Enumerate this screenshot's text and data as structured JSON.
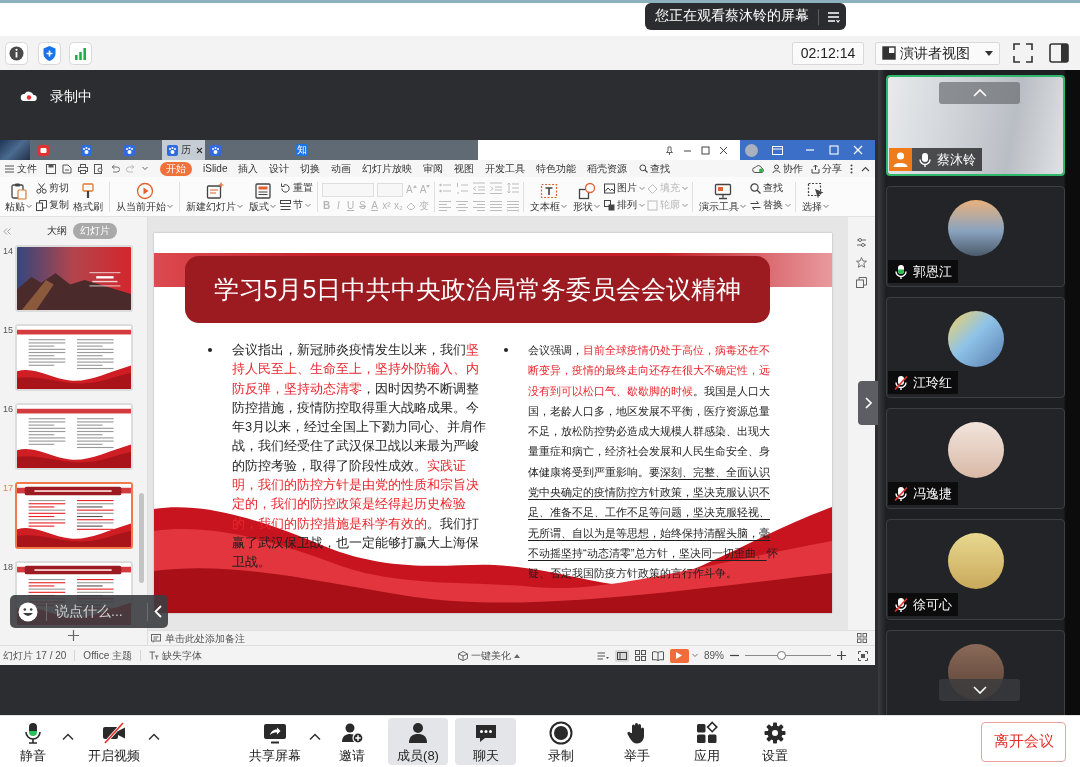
{
  "screen_share_banner": {
    "text": "您正在观看蔡沐铃的屏幕"
  },
  "meeting_bar": {
    "timer": "02:12:14",
    "view_mode": "演讲者视图"
  },
  "recording": {
    "label": "录制中"
  },
  "shared_window": {
    "browser_tabs": [
      {
        "kind": "app",
        "selected": false
      },
      {
        "kind": "paw",
        "selected": false
      },
      {
        "kind": "paw",
        "selected": false
      },
      {
        "kind": "paw",
        "selected": true,
        "label": "历"
      },
      {
        "kind": "paw",
        "selected": false
      },
      {
        "kind": "letter",
        "icon_text": "知",
        "selected": false
      }
    ],
    "menu": {
      "file": "文件",
      "tabs": [
        {
          "label": "开始",
          "selected": true
        },
        {
          "label": "iSlide",
          "selected": false
        },
        {
          "label": "插入",
          "selected": false
        },
        {
          "label": "设计",
          "selected": false
        },
        {
          "label": "切换",
          "selected": false
        },
        {
          "label": "动画",
          "selected": false
        },
        {
          "label": "幻灯片放映",
          "selected": false
        },
        {
          "label": "审阅",
          "selected": false
        },
        {
          "label": "视图",
          "selected": false
        },
        {
          "label": "开发工具",
          "selected": false
        },
        {
          "label": "特色功能",
          "selected": false
        },
        {
          "label": "稻壳资源",
          "selected": false
        }
      ],
      "search": "查找",
      "actions": [
        "协作",
        "分享"
      ]
    },
    "ribbon": [
      {
        "kind": "large",
        "label": "粘贴",
        "dropdown": true,
        "disabled": false
      },
      {
        "kind": "stack",
        "items": [
          {
            "label": "剪切",
            "dropdown": false,
            "disabled": false
          },
          {
            "label": "复制",
            "dropdown": false,
            "disabled": false
          }
        ]
      },
      {
        "kind": "large",
        "label": "格式刷",
        "dropdown": false,
        "disabled": false
      },
      {
        "kind": "separator"
      },
      {
        "kind": "large",
        "label": "从当前开始",
        "dropdown": true,
        "disabled": false
      },
      {
        "kind": "separator"
      },
      {
        "kind": "large",
        "label": "新建幻灯片",
        "dropdown": true,
        "disabled": false
      },
      {
        "kind": "large",
        "label": "版式",
        "dropdown": true,
        "disabled": false
      },
      {
        "kind": "stack",
        "items": [
          {
            "label": "重置",
            "dropdown": false,
            "disabled": false
          },
          {
            "label": "节",
            "dropdown": true,
            "disabled": false
          }
        ]
      },
      {
        "kind": "separator"
      },
      {
        "kind": "font_tools",
        "disabled": true,
        "size_buttons": [
          "A",
          "A"
        ],
        "format_buttons": [
          "B",
          "I",
          "U",
          "S",
          "A",
          "x²",
          "x₂",
          "变"
        ]
      },
      {
        "kind": "separator"
      },
      {
        "kind": "paragraph_tools",
        "disabled": true
      },
      {
        "kind": "separator"
      },
      {
        "kind": "large",
        "label": "文本框",
        "dropdown": true,
        "disabled": false
      },
      {
        "kind": "large",
        "label": "形状",
        "dropdown": true,
        "disabled": false
      },
      {
        "kind": "stack",
        "items": [
          {
            "label": "图片",
            "dropdown": true,
            "disabled": false
          },
          {
            "label": "排列",
            "dropdown": true,
            "disabled": false
          }
        ]
      },
      {
        "kind": "stack",
        "items": [
          {
            "label": "填充",
            "dropdown": true,
            "disabled": true
          },
          {
            "label": "轮廓",
            "dropdown": true,
            "disabled": true
          }
        ]
      },
      {
        "kind": "separator"
      },
      {
        "kind": "large",
        "label": "演示工具",
        "dropdown": true,
        "disabled": false
      },
      {
        "kind": "stack",
        "items": [
          {
            "label": "查找",
            "dropdown": false,
            "disabled": false
          },
          {
            "label": "替换",
            "dropdown": true,
            "disabled": false
          }
        ]
      },
      {
        "kind": "separator"
      },
      {
        "kind": "large",
        "label": "选择",
        "dropdown": true,
        "disabled": false
      }
    ],
    "slide_panel": {
      "tabs": [
        {
          "label": "大纲",
          "selected": false
        },
        {
          "label": "幻灯片",
          "selected": true
        }
      ],
      "thumbnails": [
        {
          "number": "14",
          "kind": "cover",
          "selected": false
        },
        {
          "number": "15",
          "kind": "text",
          "selected": false
        },
        {
          "number": "16",
          "kind": "text",
          "selected": false
        },
        {
          "number": "17",
          "kind": "titled",
          "selected": true
        },
        {
          "number": "18",
          "kind": "titled",
          "selected": false
        }
      ]
    },
    "slide": {
      "title": "学习5月5日中共中央政治局常务委员会会议精神",
      "bullets": [
        {
          "runs": [
            {
              "kind": "plain",
              "text": "会议指出，新冠肺炎疫情发生以来，我们"
            },
            {
              "kind": "red",
              "text": "坚持人民至上、生命至上，坚持外防输入、内防反弹，坚持动态清零"
            },
            {
              "kind": "plain",
              "text": "，因时因势不断调整防控措施，疫情防控取得重大战略成果。今年3月以来，经过全国上下勠力同心、并肩作战，我们经受住了武汉保卫战以来最为严峻的防控考验，取得了阶段性成效。"
            },
            {
              "kind": "red",
              "text": "实践证明，我们的防控方针是由党的性质和宗旨决定的，我们的防控政策是经得起历史检验的，我们的防控措施是科学有效的"
            },
            {
              "kind": "plain",
              "text": "。我们打赢了武汉保卫战，也一定能够打赢大上海保卫战。"
            }
          ]
        },
        {
          "runs": [
            {
              "kind": "plain",
              "text": "会议强调，"
            },
            {
              "kind": "red",
              "text": "目前全球疫情仍处于高位，病毒还在不断变异，疫情的最终走向还存在很大不确定性，远没有到可以松口气、歇歇脚的时候"
            },
            {
              "kind": "plain",
              "text": "。我国是人口大国，老龄人口多，地区发展不平衡，医疗资源总量不足，放松防控势必造成大规模人群感染、出现大量重症和病亡，经济社会发展和人民生命安全、身体健康将受到严重影响。要"
            },
            {
              "kind": "underline",
              "text": "深刻、完整、全面认识党中央确定的疫情防控方针政策，坚决克服认识不足、准备不足、工作不足等问题，坚决克服轻视、无所谓、自以为是等思想，始终保持清醒头脑，毫不动摇坚持“动态清零”总方针，坚决同一切歪曲、"
            },
            {
              "kind": "plain",
              "text": "怀疑、否定我国防疫方针政策的言行作斗争。"
            }
          ]
        }
      ]
    },
    "notes": {
      "placeholder": "单击此处添加备注"
    },
    "status_bar": {
      "slide_counter": "幻灯片 17 / 20",
      "theme": "Office 主题",
      "missing_fonts": "缺失字体",
      "beautify": "一键美化",
      "zoom_reading": "89%",
      "zoom_slider": {
        "level": 0.43
      }
    }
  },
  "chat_input": {
    "placeholder": "说点什么..."
  },
  "participants": [
    {
      "name": "蔡沐铃",
      "kind": "video",
      "muted": false,
      "talking": false,
      "host": true,
      "highlighted": true
    },
    {
      "name": "郭恩江",
      "kind": "avatar",
      "muted": false,
      "talking": true,
      "host": false,
      "highlighted": false
    },
    {
      "name": "江玲红",
      "kind": "avatar",
      "muted": true,
      "talking": false,
      "host": false,
      "highlighted": false
    },
    {
      "name": "冯逸捷",
      "kind": "avatar",
      "muted": true,
      "talking": false,
      "host": false,
      "highlighted": false
    },
    {
      "name": "徐可心",
      "kind": "avatar",
      "muted": true,
      "talking": false,
      "host": false,
      "highlighted": false
    },
    {
      "kind": "avatar",
      "host": false,
      "highlighted": false
    }
  ],
  "dock": {
    "items": [
      {
        "kind": "mic",
        "label": "静音",
        "has_menu": true,
        "selected": false
      },
      {
        "kind": "camera",
        "label": "开启视频",
        "has_menu": true,
        "selected": false
      },
      {
        "kind": "share",
        "label": "共享屏幕",
        "has_menu": true,
        "selected": false
      },
      {
        "kind": "invite",
        "label": "邀请",
        "has_menu": false,
        "selected": false
      },
      {
        "kind": "members",
        "label": "成员(8)",
        "has_menu": false,
        "selected": true
      },
      {
        "kind": "chat",
        "label": "聊天",
        "has_menu": false,
        "selected": true
      },
      {
        "kind": "record",
        "label": "录制",
        "has_menu": false,
        "selected": false
      },
      {
        "kind": "hand",
        "label": "举手",
        "has_menu": false,
        "selected": false
      },
      {
        "kind": "apps",
        "label": "应用",
        "has_menu": false,
        "selected": false
      },
      {
        "kind": "settings",
        "label": "设置",
        "has_menu": false,
        "selected": false
      }
    ],
    "leave": "离开会议"
  }
}
